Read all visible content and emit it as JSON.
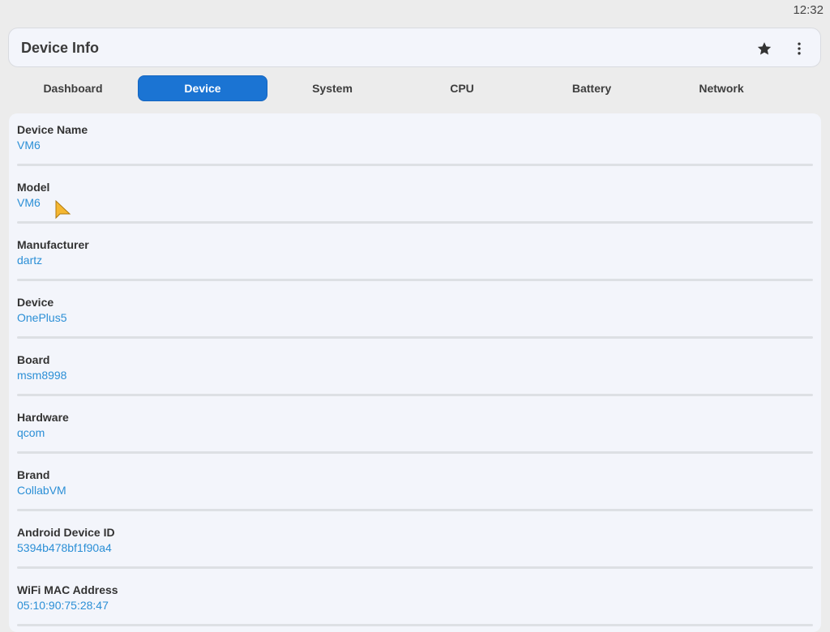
{
  "status_bar": {
    "time": "12:32"
  },
  "app_bar": {
    "title": "Device Info",
    "icons": [
      "star-icon",
      "more-vert-icon"
    ]
  },
  "tabs": [
    {
      "label": "Dashboard",
      "active": false
    },
    {
      "label": "Device",
      "active": true
    },
    {
      "label": "System",
      "active": false
    },
    {
      "label": "CPU",
      "active": false
    },
    {
      "label": "Battery",
      "active": false
    },
    {
      "label": "Network",
      "active": false
    }
  ],
  "device_info": [
    {
      "label": "Device Name",
      "value": "VM6"
    },
    {
      "label": "Model",
      "value": "VM6"
    },
    {
      "label": "Manufacturer",
      "value": "dartz"
    },
    {
      "label": "Device",
      "value": "OnePlus5"
    },
    {
      "label": "Board",
      "value": "msm8998"
    },
    {
      "label": "Hardware",
      "value": "qcom"
    },
    {
      "label": "Brand",
      "value": "CollabVM"
    },
    {
      "label": "Android Device ID",
      "value": "5394b478bf1f90a4"
    },
    {
      "label": "WiFi MAC Address",
      "value": "05:10:90:75:28:47"
    }
  ],
  "colors": {
    "accent": "#1b74d3",
    "value_text": "#2b8fd6",
    "background": "#ececec",
    "card": "#f3f5fb"
  }
}
